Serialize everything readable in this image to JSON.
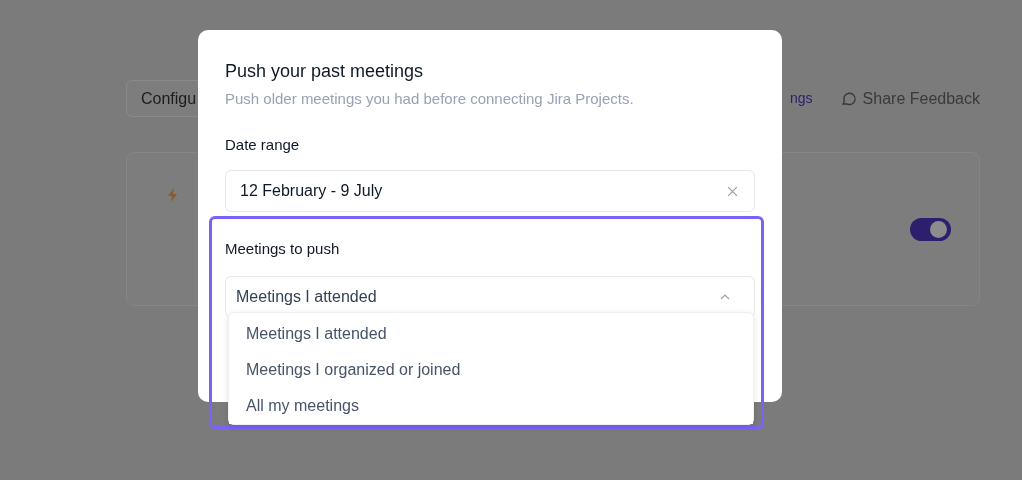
{
  "background": {
    "config_button": "Configu",
    "link": "ngs",
    "feedback_link": "Share Feedback",
    "toggle": {
      "on": true
    }
  },
  "modal": {
    "title": "Push your past meetings",
    "subtitle": "Push older meetings you had before connecting Jira Projects.",
    "date_range": {
      "label": "Date range",
      "value": "12 February - 9 July"
    },
    "meetings": {
      "label": "Meetings to push",
      "value": "Meetings I attended",
      "expanded": true,
      "options": [
        {
          "label": "Meetings I attended"
        },
        {
          "label": "Meetings I organized or joined"
        },
        {
          "label": "All my meetings"
        }
      ]
    }
  }
}
